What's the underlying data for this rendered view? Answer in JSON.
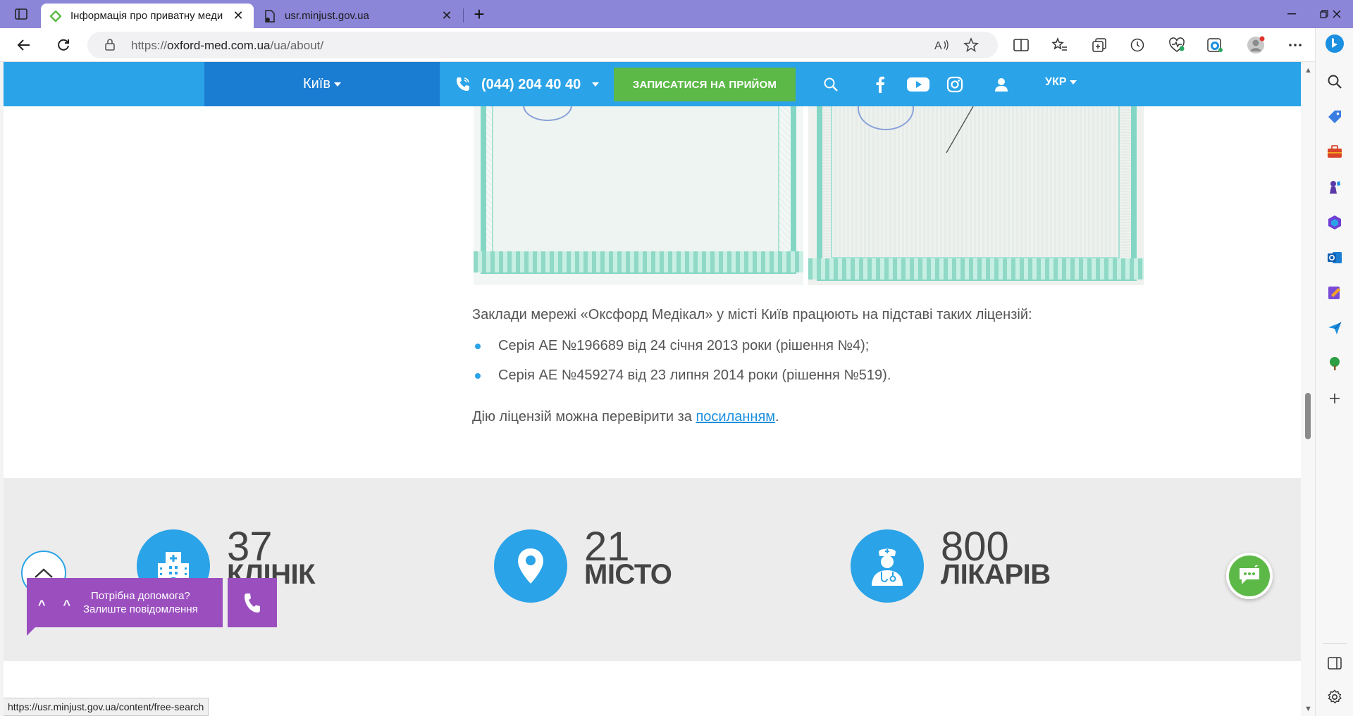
{
  "browser": {
    "tabs": [
      {
        "title": "Інформація про приватну меди",
        "active": true,
        "icon": "oxford-med-favicon"
      },
      {
        "title": "usr.minjust.gov.ua",
        "active": false,
        "icon": "page-icon"
      }
    ],
    "url_prefix": "https://",
    "url_host": "oxford-med.com.ua",
    "url_path": "/ua/about/",
    "status_url": "https://usr.minjust.gov.ua/content/free-search"
  },
  "header": {
    "city": "Київ",
    "phone": "(044) 204 40 40",
    "book_button": "ЗАПИСАТИСЯ НА ПРИЙОМ",
    "language": "УКР"
  },
  "license": {
    "intro": "Заклади мережі «Оксфорд Медікал» у місті Київ працюють на підставі таких ліцензій:",
    "items": [
      "Серія АЕ №196689 від 24 січня 2013 роки (рішення №4);",
      "Серія АЕ №459274 від 23 липня 2014 роки (рішення №519)."
    ],
    "check_prefix": "Дію ліцензій можна перевірити за ",
    "check_link": "посиланням",
    "check_suffix": "."
  },
  "stats": [
    {
      "number": "37",
      "label": "КЛІНІК",
      "icon": "hospital-icon"
    },
    {
      "number": "21",
      "label": "МІСТО",
      "icon": "location-pin-icon"
    },
    {
      "number": "800",
      "label": "ЛІКАРІВ",
      "icon": "doctor-icon"
    }
  ],
  "help": {
    "line1": "Потрібна допомога?",
    "line2": "Залиште повідомлення",
    "face": "^ ^"
  },
  "colors": {
    "brand_blue": "#2aa3e8",
    "brand_dark_blue": "#1b7dd2",
    "green": "#5cb947",
    "purple": "#9b4fbf",
    "titlebar": "#8b86d8"
  }
}
